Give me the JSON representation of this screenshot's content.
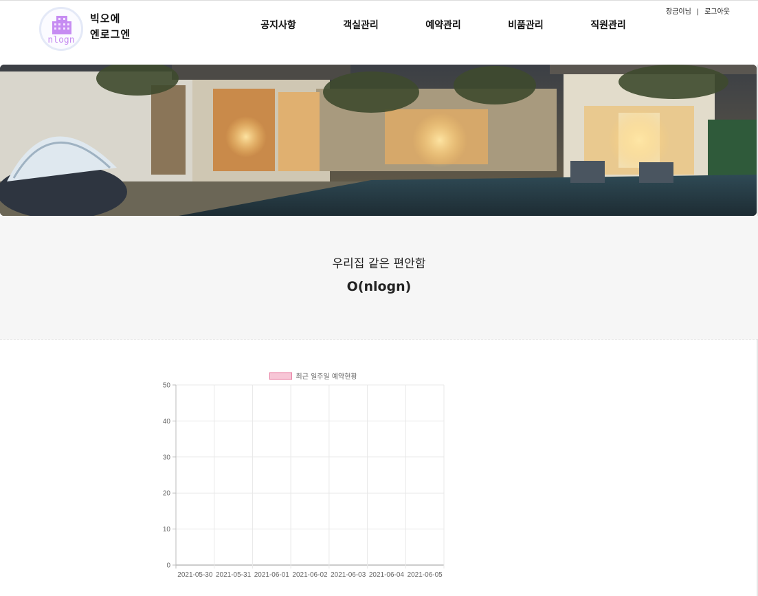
{
  "header": {
    "logo": {
      "subtitle": "nlogn"
    },
    "brand": {
      "line1": "빅오에",
      "line2": "엔로그엔"
    },
    "nav": [
      {
        "label": "공지사항"
      },
      {
        "label": "객실관리"
      },
      {
        "label": "예약관리"
      },
      {
        "label": "비품관리"
      },
      {
        "label": "직원관리"
      }
    ],
    "user": {
      "greeting": "장금이님",
      "separator": "|",
      "logout": "로그아웃"
    }
  },
  "hero": {
    "tagline": "우리집 같은 편안함",
    "brand": "O(nlogn)"
  },
  "chart_data": {
    "type": "bar",
    "legend_position": "top",
    "series": [
      {
        "name": "최근 일주일 예약현황",
        "values": [
          0,
          0,
          0,
          0,
          0,
          0,
          0
        ],
        "color": "#f7c6d6",
        "border": "#e87fa3"
      }
    ],
    "categories": [
      "2021-05-30",
      "2021-05-31",
      "2021-06-01",
      "2021-06-02",
      "2021-06-03",
      "2021-06-04",
      "2021-06-05"
    ],
    "ylim": [
      0,
      50
    ],
    "yticks": [
      0,
      10,
      20,
      30,
      40,
      50
    ],
    "grid": true
  },
  "colors": {
    "accent": "#c58af0",
    "tagline_bg": "#f6f6f6"
  }
}
